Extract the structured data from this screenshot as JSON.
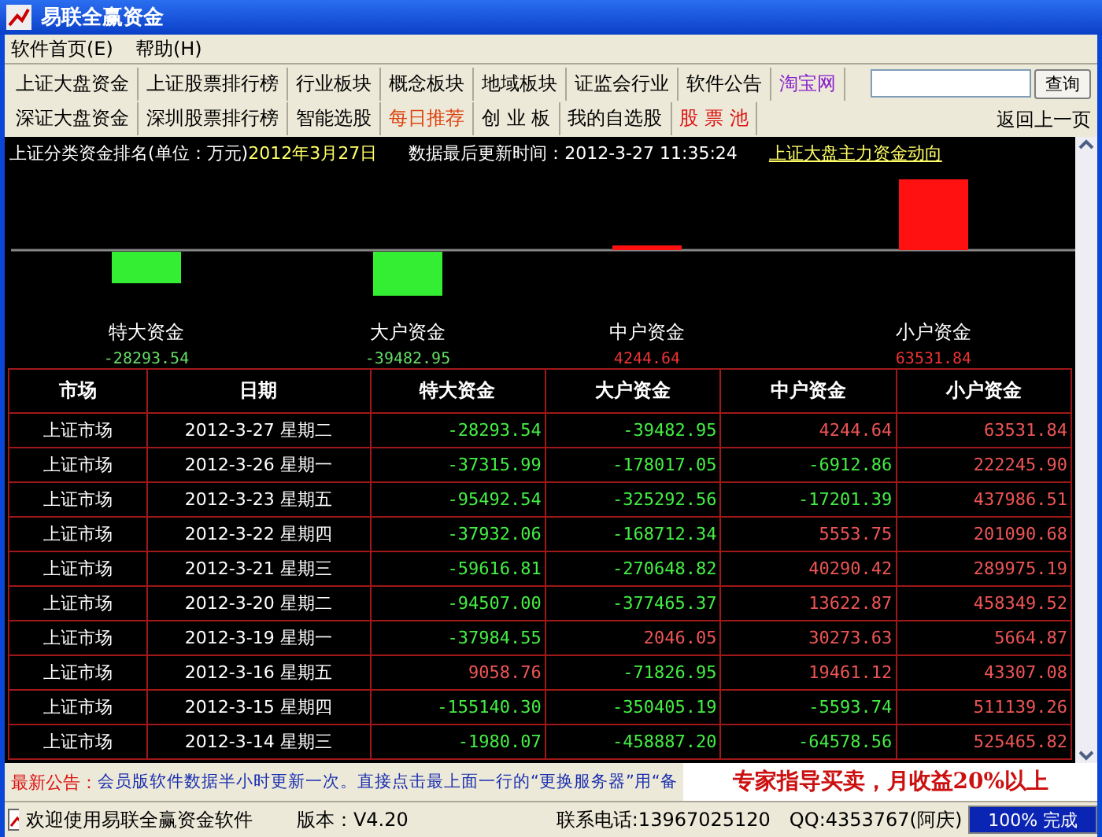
{
  "window": {
    "title": "易联全赢资金"
  },
  "menu": [
    {
      "label": "软件首页(E)"
    },
    {
      "label": "帮助(H)"
    }
  ],
  "toolbar": {
    "rows": [
      [
        {
          "label": "上证大盘资金",
          "color": "#000000"
        },
        {
          "label": "上证股票排行榜",
          "color": "#000000"
        },
        {
          "label": "行业板块",
          "color": "#000000"
        },
        {
          "label": "概念板块",
          "color": "#000000"
        },
        {
          "label": "地域板块",
          "color": "#000000"
        },
        {
          "label": "证监会行业",
          "color": "#000000"
        },
        {
          "label": "软件公告",
          "color": "#000000"
        },
        {
          "label": "淘宝网",
          "color": "#8822cc"
        }
      ],
      [
        {
          "label": "深证大盘资金",
          "color": "#000000"
        },
        {
          "label": "深圳股票排行榜",
          "color": "#000000"
        },
        {
          "label": "智能选股",
          "color": "#000000"
        },
        {
          "label": "每日推荐",
          "color": "#dd4411"
        },
        {
          "label": "创 业 板",
          "color": "#000000"
        },
        {
          "label": "我的自选股",
          "color": "#000000"
        },
        {
          "label": "股 票 池",
          "color": "#dd1111"
        }
      ]
    ],
    "search_button": "查询",
    "back": "返回上一页"
  },
  "info": {
    "title": "上证分类资金排名(单位：万元)",
    "date": "2012年3月27日",
    "updated": "数据最后更新时间：2012-3-27 11:35:24",
    "link": "上证大盘主力资金动向"
  },
  "chart_data": {
    "type": "bar",
    "categories": [
      "特大资金",
      "大户资金",
      "中户资金",
      "小户资金"
    ],
    "values": [
      -28293.54,
      -39482.95,
      4244.64,
      63531.84
    ],
    "data_labels": true,
    "value_labels": [
      "-28293.54",
      "-39482.95",
      "4244.64",
      "63531.84"
    ]
  },
  "table": {
    "columns": [
      "市场",
      "日期",
      "特大资金",
      "大户资金",
      "中户资金",
      "小户资金"
    ],
    "rows": [
      {
        "market": "上证市场",
        "date": "2012-3-27 星期二",
        "values": [
          {
            "text": "-28293.54",
            "color": "#44ee44"
          },
          {
            "text": "-39482.95",
            "color": "#44ee44"
          },
          {
            "text": "4244.64",
            "color": "#ee5555"
          },
          {
            "text": "63531.84",
            "color": "#ee5555"
          }
        ]
      },
      {
        "market": "上证市场",
        "date": "2012-3-26 星期一",
        "values": [
          {
            "text": "-37315.99",
            "color": "#44ee44"
          },
          {
            "text": "-178017.05",
            "color": "#44ee44"
          },
          {
            "text": "-6912.86",
            "color": "#44ee44"
          },
          {
            "text": "222245.90",
            "color": "#ee5555"
          }
        ]
      },
      {
        "market": "上证市场",
        "date": "2012-3-23 星期五",
        "values": [
          {
            "text": "-95492.54",
            "color": "#44ee44"
          },
          {
            "text": "-325292.56",
            "color": "#44ee44"
          },
          {
            "text": "-17201.39",
            "color": "#44ee44"
          },
          {
            "text": "437986.51",
            "color": "#ee5555"
          }
        ]
      },
      {
        "market": "上证市场",
        "date": "2012-3-22 星期四",
        "values": [
          {
            "text": "-37932.06",
            "color": "#44ee44"
          },
          {
            "text": "-168712.34",
            "color": "#44ee44"
          },
          {
            "text": "5553.75",
            "color": "#ee5555"
          },
          {
            "text": "201090.68",
            "color": "#ee5555"
          }
        ]
      },
      {
        "market": "上证市场",
        "date": "2012-3-21 星期三",
        "values": [
          {
            "text": "-59616.81",
            "color": "#44ee44"
          },
          {
            "text": "-270648.82",
            "color": "#44ee44"
          },
          {
            "text": "40290.42",
            "color": "#ee5555"
          },
          {
            "text": "289975.19",
            "color": "#ee5555"
          }
        ]
      },
      {
        "market": "上证市场",
        "date": "2012-3-20 星期二",
        "values": [
          {
            "text": "-94507.00",
            "color": "#44ee44"
          },
          {
            "text": "-377465.37",
            "color": "#44ee44"
          },
          {
            "text": "13622.87",
            "color": "#ee5555"
          },
          {
            "text": "458349.52",
            "color": "#ee5555"
          }
        ]
      },
      {
        "market": "上证市场",
        "date": "2012-3-19 星期一",
        "values": [
          {
            "text": "-37984.55",
            "color": "#44ee44"
          },
          {
            "text": "2046.05",
            "color": "#ee5555"
          },
          {
            "text": "30273.63",
            "color": "#ee5555"
          },
          {
            "text": "5664.87",
            "color": "#ee5555"
          }
        ]
      },
      {
        "market": "上证市场",
        "date": "2012-3-16 星期五",
        "values": [
          {
            "text": "9058.76",
            "color": "#ee5555"
          },
          {
            "text": "-71826.95",
            "color": "#44ee44"
          },
          {
            "text": "19461.12",
            "color": "#ee5555"
          },
          {
            "text": "43307.08",
            "color": "#ee5555"
          }
        ]
      },
      {
        "market": "上证市场",
        "date": "2012-3-15 星期四",
        "values": [
          {
            "text": "-155140.30",
            "color": "#44ee44"
          },
          {
            "text": "-350405.19",
            "color": "#44ee44"
          },
          {
            "text": "-5593.74",
            "color": "#44ee44"
          },
          {
            "text": "511139.26",
            "color": "#ee5555"
          }
        ]
      },
      {
        "market": "上证市场",
        "date": "2012-3-14 星期三",
        "values": [
          {
            "text": "-1980.07",
            "color": "#44ee44"
          },
          {
            "text": "-458887.20",
            "color": "#44ee44"
          },
          {
            "text": "-64578.56",
            "color": "#44ee44"
          },
          {
            "text": "525465.82",
            "color": "#ee5555"
          }
        ]
      }
    ]
  },
  "notice": {
    "label": "最新公告：",
    "text": "会员版软件数据半小时更新一次。直接点击最上面一行的“更换服务器”用“备",
    "ad": "专家指导买卖，月收益20%以上"
  },
  "status_bar": {
    "welcome": "欢迎使用易联全赢资金软件",
    "version": "版本：V4.20",
    "phone": "联系电话:13967025120",
    "qq": "QQ:4353767(阿庆)",
    "progress": {
      "label": "100% 完成",
      "level": 1
    }
  }
}
